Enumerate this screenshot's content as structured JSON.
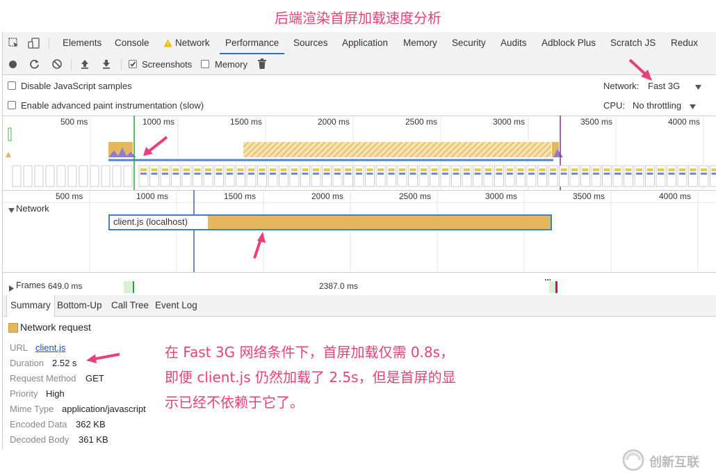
{
  "page_title": "后端渲染首屏加载速度分析",
  "tabs": [
    {
      "label": "Elements"
    },
    {
      "label": "Console"
    },
    {
      "label": "Network",
      "warning": true
    },
    {
      "label": "Performance",
      "active": true
    },
    {
      "label": "Sources"
    },
    {
      "label": "Application"
    },
    {
      "label": "Memory"
    },
    {
      "label": "Security"
    },
    {
      "label": "Audits"
    },
    {
      "label": "Adblock Plus"
    },
    {
      "label": "Scratch JS"
    },
    {
      "label": "Redux"
    }
  ],
  "toolbar": {
    "screenshots_label": "Screenshots",
    "screenshots_checked": true,
    "memory_label": "Memory",
    "memory_checked": false
  },
  "options": {
    "disable_js_samples": "Disable JavaScript samples",
    "advanced_paint": "Enable advanced paint instrumentation (slow)",
    "network_label": "Network:",
    "network_value": "Fast 3G",
    "cpu_label": "CPU:",
    "cpu_value": "No throttling"
  },
  "overview_ticks": [
    "500 ms",
    "1000 ms",
    "1500 ms",
    "2000 ms",
    "2500 ms",
    "3000 ms",
    "3500 ms",
    "4000 ms"
  ],
  "flame_ticks": [
    "500 ms",
    "1000 ms",
    "1500 ms",
    "2000 ms",
    "2500 ms",
    "3000 ms",
    "3500 ms",
    "4000 ms"
  ],
  "network_section": {
    "label": "Network",
    "request_label": "client.js (localhost)",
    "request_color": "#e5b85f"
  },
  "frames": {
    "label": "Frames",
    "first": "649.0 ms",
    "second": "2387.0 ms",
    "ellipsis": "..."
  },
  "subtabs": [
    {
      "label": "Summary",
      "active": true
    },
    {
      "label": "Bottom-Up"
    },
    {
      "label": "Call Tree"
    },
    {
      "label": "Event Log"
    }
  ],
  "summary": {
    "heading": "Network request",
    "rows": [
      {
        "label": "URL",
        "value": "client.js",
        "link": true
      },
      {
        "label": "Duration",
        "value": "2.52 s"
      },
      {
        "label": "Request Method",
        "value": "GET"
      },
      {
        "label": "Priority",
        "value": "High"
      },
      {
        "label": "Mime Type",
        "value": "application/javascript"
      },
      {
        "label": "Encoded Data",
        "value": "362 KB"
      },
      {
        "label": "Decoded Body",
        "value": "361 KB"
      }
    ]
  },
  "annotation": {
    "line1": "在 Fast 3G 网络条件下，首屏加载仅需 0.8s，",
    "line2": "即便 client.js 仍然加载了 2.5s，但是首屏的显",
    "line3": "示已经不依赖于它了。"
  },
  "watermark": "创新互联",
  "colors": {
    "accent": "#e8407a",
    "active_tab": "#1a73e8",
    "request_bar": "#e5b85f",
    "marker_green": "#2e9e3e",
    "marker_purple": "#8b2a8f",
    "link": "#1a4fb5"
  }
}
